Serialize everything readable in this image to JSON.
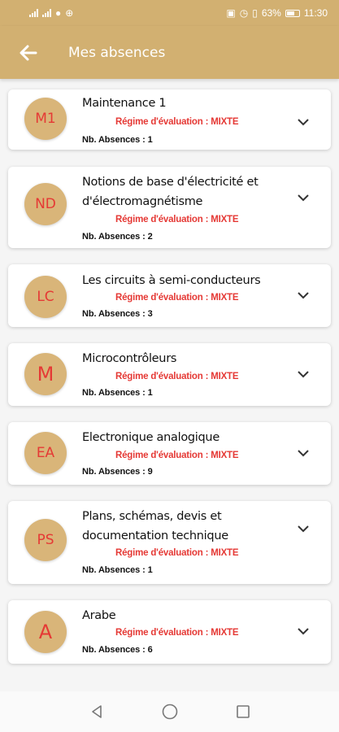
{
  "status_bar": {
    "battery": "63%",
    "time": "11:30"
  },
  "app_bar": {
    "title": "Mes absences"
  },
  "courses": [
    {
      "initials": "M1",
      "title": "Maintenance 1",
      "regime": "Régime d'évaluation : MIXTE",
      "absences": "Nb. Absences : 1"
    },
    {
      "initials": "ND",
      "title": "Notions de base d'électricité et d'électromagnétisme",
      "regime": "Régime d'évaluation : MIXTE",
      "absences": "Nb. Absences : 2"
    },
    {
      "initials": "LC",
      "title": "Les circuits à semi-conducteurs",
      "regime": "Régime d'évaluation : MIXTE",
      "absences": "Nb. Absences : 3"
    },
    {
      "initials": "M",
      "title": "Microcontrôleurs",
      "regime": "Régime d'évaluation : MIXTE",
      "absences": "Nb. Absences : 1"
    },
    {
      "initials": "EA",
      "title": "Electronique analogique",
      "regime": "Régime d'évaluation : MIXTE",
      "absences": "Nb. Absences : 9"
    },
    {
      "initials": "PS",
      "title": "Plans, schémas, devis et documentation technique",
      "regime": "Régime d'évaluation : MIXTE",
      "absences": "Nb. Absences : 1"
    },
    {
      "initials": "A",
      "title": "Arabe",
      "regime": "Régime d'évaluation : MIXTE",
      "absences": "Nb. Absences : 6"
    }
  ],
  "colors": {
    "accent": "#d2b071",
    "avatar": "#d9b579",
    "red": "#e53935"
  },
  "icons": {
    "back": "arrow-left-icon",
    "expand": "chevron-down-icon",
    "nav_back": "triangle-back-icon",
    "nav_home": "circle-home-icon",
    "nav_recent": "square-recent-icon"
  }
}
